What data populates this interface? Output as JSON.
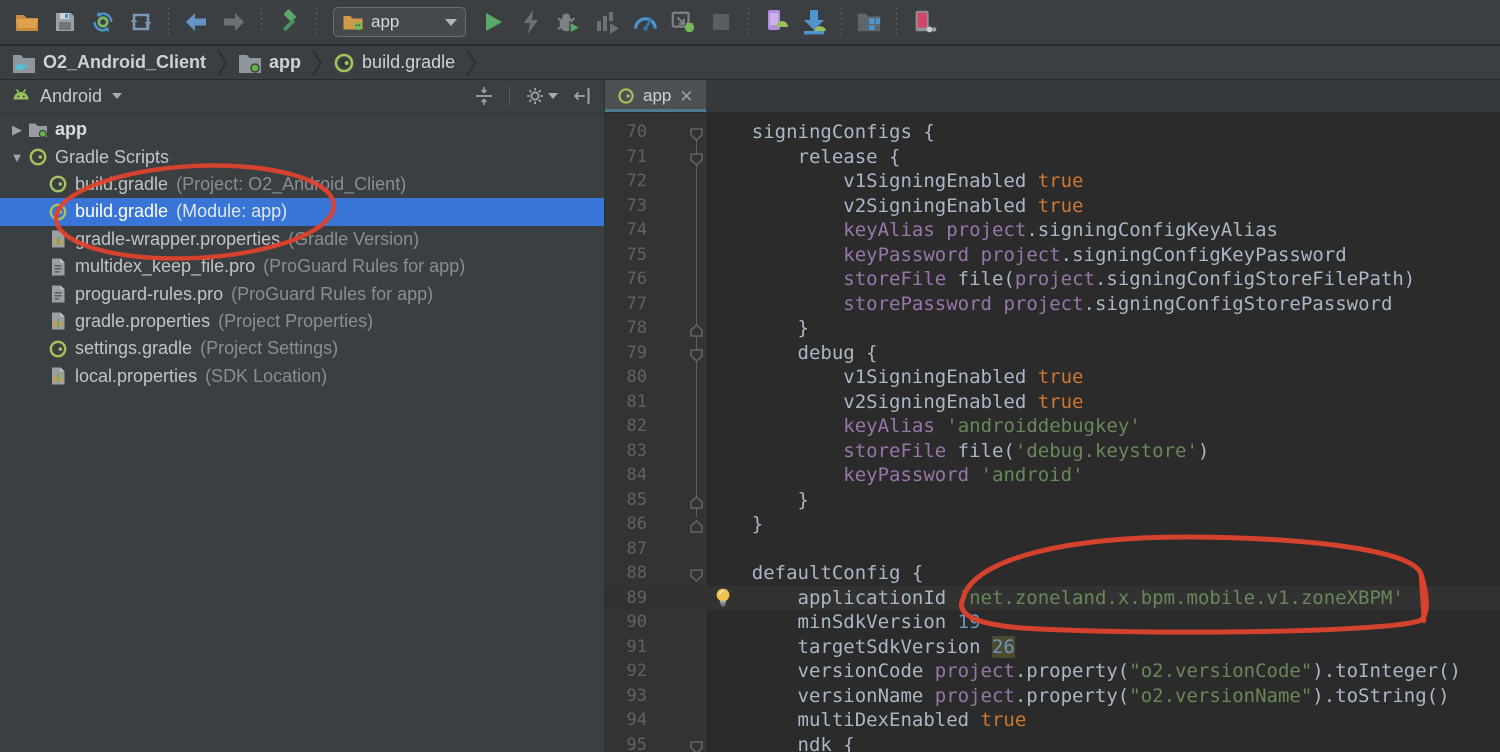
{
  "toolbar": {
    "run_config": "app",
    "icon_names": [
      "open-project-icon",
      "save-all-icon",
      "sync-gradle-icon",
      "refresh-icon",
      "back-icon",
      "forward-icon",
      "build-hammer-icon",
      "run-config-folder-icon",
      "run-icon",
      "apply-changes-icon",
      "debug-icon",
      "profile-icon",
      "profiler-icon",
      "attach-debugger-icon",
      "stop-icon",
      "avd-manager-icon",
      "sdk-manager-icon",
      "device-file-explorer-icon",
      "layout-inspector-icon"
    ]
  },
  "breadcrumb": {
    "items": [
      "O2_Android_Client",
      "app",
      "build.gradle"
    ]
  },
  "project_panel": {
    "view_selector": "Android",
    "tree": [
      {
        "label": "app",
        "hint": "",
        "icon": "folder-module",
        "level": 0,
        "arrow": "collapsed",
        "bold": true
      },
      {
        "label": "Gradle Scripts",
        "hint": "",
        "icon": "gradle",
        "level": 0,
        "arrow": "expanded"
      },
      {
        "label": "build.gradle",
        "hint": "(Project: O2_Android_Client)",
        "icon": "gradle",
        "level": 1
      },
      {
        "label": "build.gradle",
        "hint": "(Module: app)",
        "icon": "gradle",
        "level": 1,
        "selected": true
      },
      {
        "label": "gradle-wrapper.properties",
        "hint": "(Gradle Version)",
        "icon": "properties",
        "level": 1
      },
      {
        "label": "multidex_keep_file.pro",
        "hint": "(ProGuard Rules for app)",
        "icon": "textfile",
        "level": 1
      },
      {
        "label": "proguard-rules.pro",
        "hint": "(ProGuard Rules for app)",
        "icon": "textfile",
        "level": 1
      },
      {
        "label": "gradle.properties",
        "hint": "(Project Properties)",
        "icon": "properties",
        "level": 1
      },
      {
        "label": "settings.gradle",
        "hint": "(Project Settings)",
        "icon": "gradle",
        "level": 1
      },
      {
        "label": "local.properties",
        "hint": "(SDK Location)",
        "icon": "properties",
        "level": 1
      }
    ]
  },
  "editor": {
    "tab_label": "app",
    "lines": [
      {
        "n": 70,
        "fold": "open",
        "seg": [
          [
            "d",
            "    signingConfigs {"
          ]
        ]
      },
      {
        "n": 71,
        "fold": "open",
        "seg": [
          [
            "d",
            "        release {"
          ]
        ]
      },
      {
        "n": 72,
        "seg": [
          [
            "d",
            "            v1SigningEnabled "
          ],
          [
            "o",
            "true"
          ]
        ]
      },
      {
        "n": 73,
        "seg": [
          [
            "d",
            "            v2SigningEnabled "
          ],
          [
            "o",
            "true"
          ]
        ]
      },
      {
        "n": 74,
        "seg": [
          [
            "d",
            "            "
          ],
          [
            "p",
            "keyAlias"
          ],
          [
            "d",
            " "
          ],
          [
            "p",
            "project"
          ],
          [
            "d",
            ".signingConfigKeyAlias"
          ]
        ]
      },
      {
        "n": 75,
        "seg": [
          [
            "d",
            "            "
          ],
          [
            "p",
            "keyPassword"
          ],
          [
            "d",
            " "
          ],
          [
            "p",
            "project"
          ],
          [
            "d",
            ".signingConfigKeyPassword"
          ]
        ]
      },
      {
        "n": 76,
        "seg": [
          [
            "d",
            "            "
          ],
          [
            "p",
            "storeFile"
          ],
          [
            "d",
            " file("
          ],
          [
            "p",
            "project"
          ],
          [
            "d",
            ".signingConfigStoreFilePath)"
          ]
        ]
      },
      {
        "n": 77,
        "seg": [
          [
            "d",
            "            "
          ],
          [
            "p",
            "storePassword"
          ],
          [
            "d",
            " "
          ],
          [
            "p",
            "project"
          ],
          [
            "d",
            ".signingConfigStorePassword"
          ]
        ]
      },
      {
        "n": 78,
        "fold": "end",
        "seg": [
          [
            "d",
            "        }"
          ]
        ]
      },
      {
        "n": 79,
        "fold": "open",
        "seg": [
          [
            "d",
            "        debug {"
          ]
        ]
      },
      {
        "n": 80,
        "seg": [
          [
            "d",
            "            v1SigningEnabled "
          ],
          [
            "o",
            "true"
          ]
        ]
      },
      {
        "n": 81,
        "seg": [
          [
            "d",
            "            v2SigningEnabled "
          ],
          [
            "o",
            "true"
          ]
        ]
      },
      {
        "n": 82,
        "seg": [
          [
            "d",
            "            "
          ],
          [
            "p",
            "keyAlias"
          ],
          [
            "d",
            " "
          ],
          [
            "s",
            "'androiddebugkey'"
          ]
        ]
      },
      {
        "n": 83,
        "seg": [
          [
            "d",
            "            "
          ],
          [
            "p",
            "storeFile"
          ],
          [
            "d",
            " file("
          ],
          [
            "s",
            "'debug.keystore'"
          ],
          [
            "d",
            ")"
          ]
        ]
      },
      {
        "n": 84,
        "seg": [
          [
            "d",
            "            "
          ],
          [
            "p",
            "keyPassword"
          ],
          [
            "d",
            " "
          ],
          [
            "s",
            "'android'"
          ]
        ]
      },
      {
        "n": 85,
        "fold": "end",
        "seg": [
          [
            "d",
            "        }"
          ]
        ]
      },
      {
        "n": 86,
        "fold": "end",
        "seg": [
          [
            "d",
            "    }"
          ]
        ]
      },
      {
        "n": 87,
        "seg": []
      },
      {
        "n": 88,
        "fold": "open",
        "seg": [
          [
            "d",
            "    defaultConfig {"
          ]
        ]
      },
      {
        "n": 89,
        "hl": true,
        "bulb": true,
        "seg": [
          [
            "d",
            "        applicationId "
          ],
          [
            "s",
            "'net.zoneland.x.bpm.mobile.v1.zoneXBPM'"
          ]
        ]
      },
      {
        "n": 90,
        "seg": [
          [
            "d",
            "        minSdkVersion "
          ],
          [
            "n",
            "19"
          ]
        ]
      },
      {
        "n": 91,
        "seg": [
          [
            "d",
            "        targetSdkVersion "
          ],
          [
            "nh",
            "26"
          ]
        ]
      },
      {
        "n": 92,
        "seg": [
          [
            "d",
            "        versionCode "
          ],
          [
            "p",
            "project"
          ],
          [
            "d",
            ".property("
          ],
          [
            "s",
            "\"o2.versionCode\""
          ],
          [
            "d",
            ").toInteger()"
          ]
        ]
      },
      {
        "n": 93,
        "seg": [
          [
            "d",
            "        versionName "
          ],
          [
            "p",
            "project"
          ],
          [
            "d",
            ".property("
          ],
          [
            "s",
            "\"o2.versionName\""
          ],
          [
            "d",
            ").toString()"
          ]
        ]
      },
      {
        "n": 94,
        "seg": [
          [
            "d",
            "        multiDexEnabled "
          ],
          [
            "o",
            "true"
          ]
        ]
      },
      {
        "n": 95,
        "fold": "open",
        "seg": [
          [
            "d",
            "        ndk {"
          ]
        ]
      }
    ]
  },
  "annotations": {
    "color": "#e1432c",
    "marks": [
      "ellipse around tree item build.gradle (Module: app)",
      "ellipse around applicationId string on line 89"
    ]
  },
  "colors": {
    "panel_bg": "#3c3f41",
    "editor_bg": "#2b2b2b",
    "gutter_bg": "#313335",
    "selection_blue": "#3875d6",
    "default_text": "#a9b7c6",
    "property_purple": "#9876aa",
    "keyword_orange": "#cc7832",
    "string_green": "#6a8759",
    "number_blue": "#6897bb",
    "line_number_gray": "#606366",
    "annotation_red": "#e1432c"
  }
}
